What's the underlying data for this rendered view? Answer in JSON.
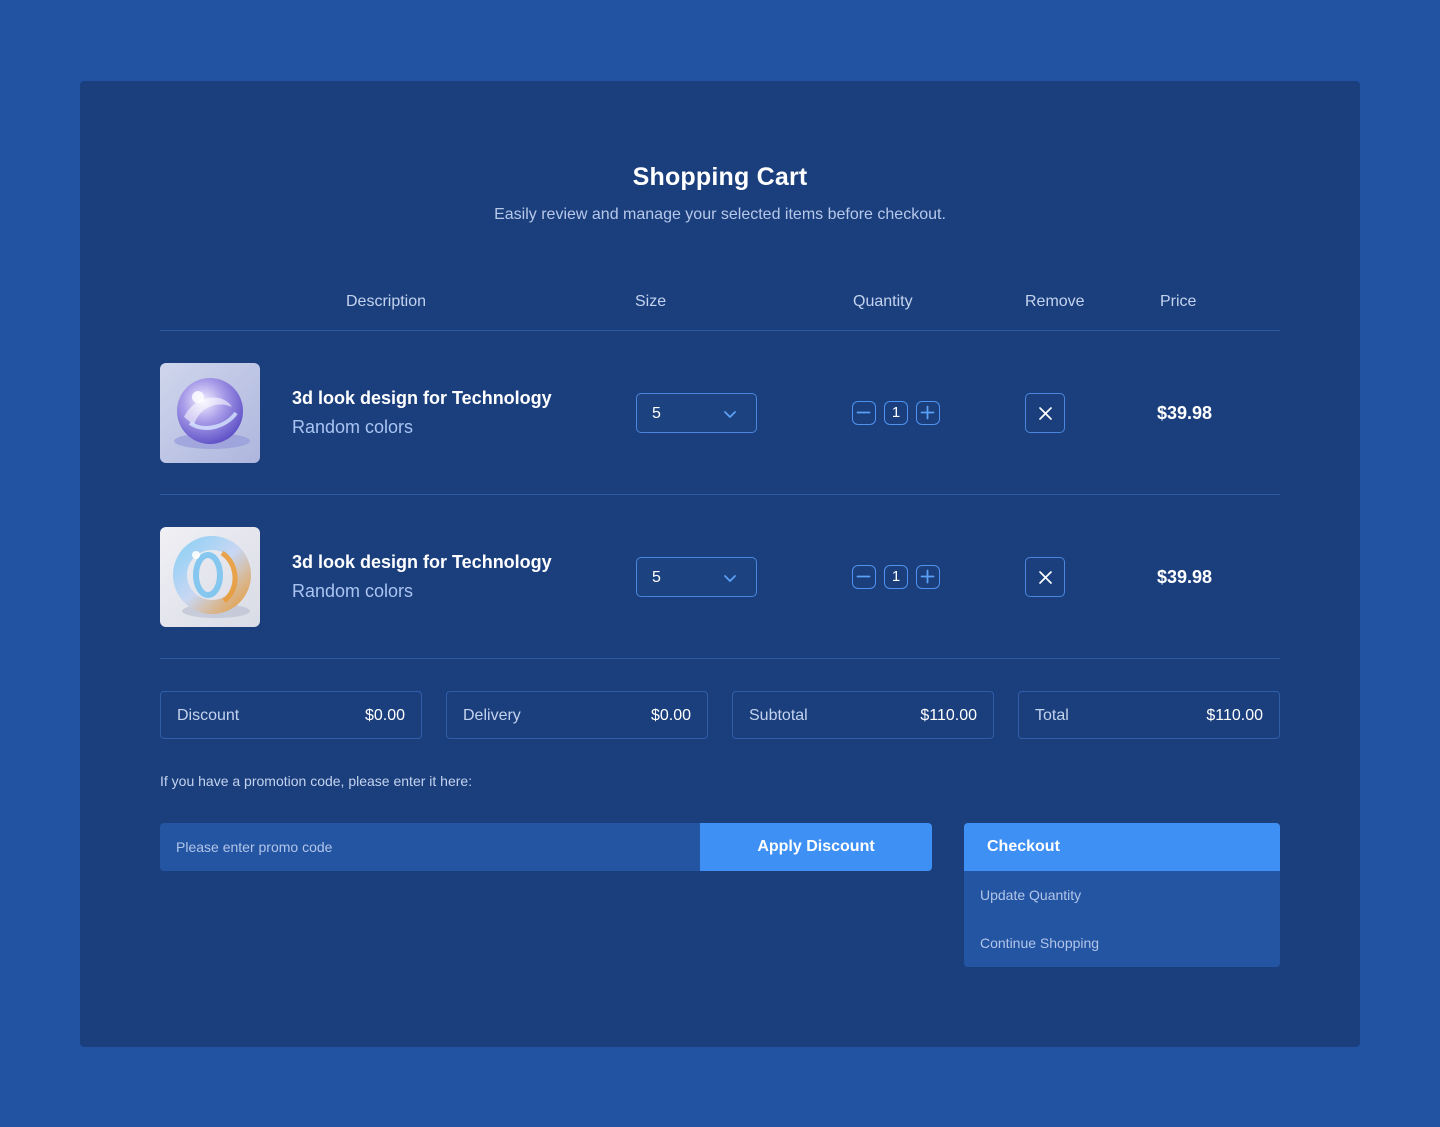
{
  "header": {
    "title": "Shopping Cart",
    "subtitle": "Easily review and manage your selected items before checkout."
  },
  "table": {
    "columns": [
      "Description",
      "Size",
      "Quantity",
      "Remove",
      "Price"
    ]
  },
  "items": [
    {
      "name": "3d look design for Technology",
      "variant": "Random colors",
      "size": "5",
      "quantity": "1",
      "price": "$39.98",
      "thumbnail_icon": "glass-sphere-image"
    },
    {
      "name": "3d look design for Technology",
      "variant": "Random colors",
      "size": "5",
      "quantity": "1",
      "price": "$39.98",
      "thumbnail_icon": "glass-ring-image"
    }
  ],
  "summary": {
    "discount_label": "Discount",
    "discount_value": "$0.00",
    "delivery_label": "Delivery",
    "delivery_value": "$0.00",
    "subtotal_label": "Subtotal",
    "subtotal_value": "$110.00",
    "total_label": "Total",
    "total_value": "$110.00"
  },
  "promo": {
    "prompt": "If you have a promotion code, please enter it here:",
    "placeholder": "Please enter promo code",
    "value": "",
    "apply_label": "Apply Discount"
  },
  "actions": {
    "checkout_label": "Checkout",
    "update_label": "Update Quantity",
    "continue_label": "Continue Shopping"
  },
  "colors": {
    "page_background": "#2253a3",
    "card_background": "#1b3f7d",
    "accent": "#3f90f5",
    "border": "#4a86dc"
  }
}
